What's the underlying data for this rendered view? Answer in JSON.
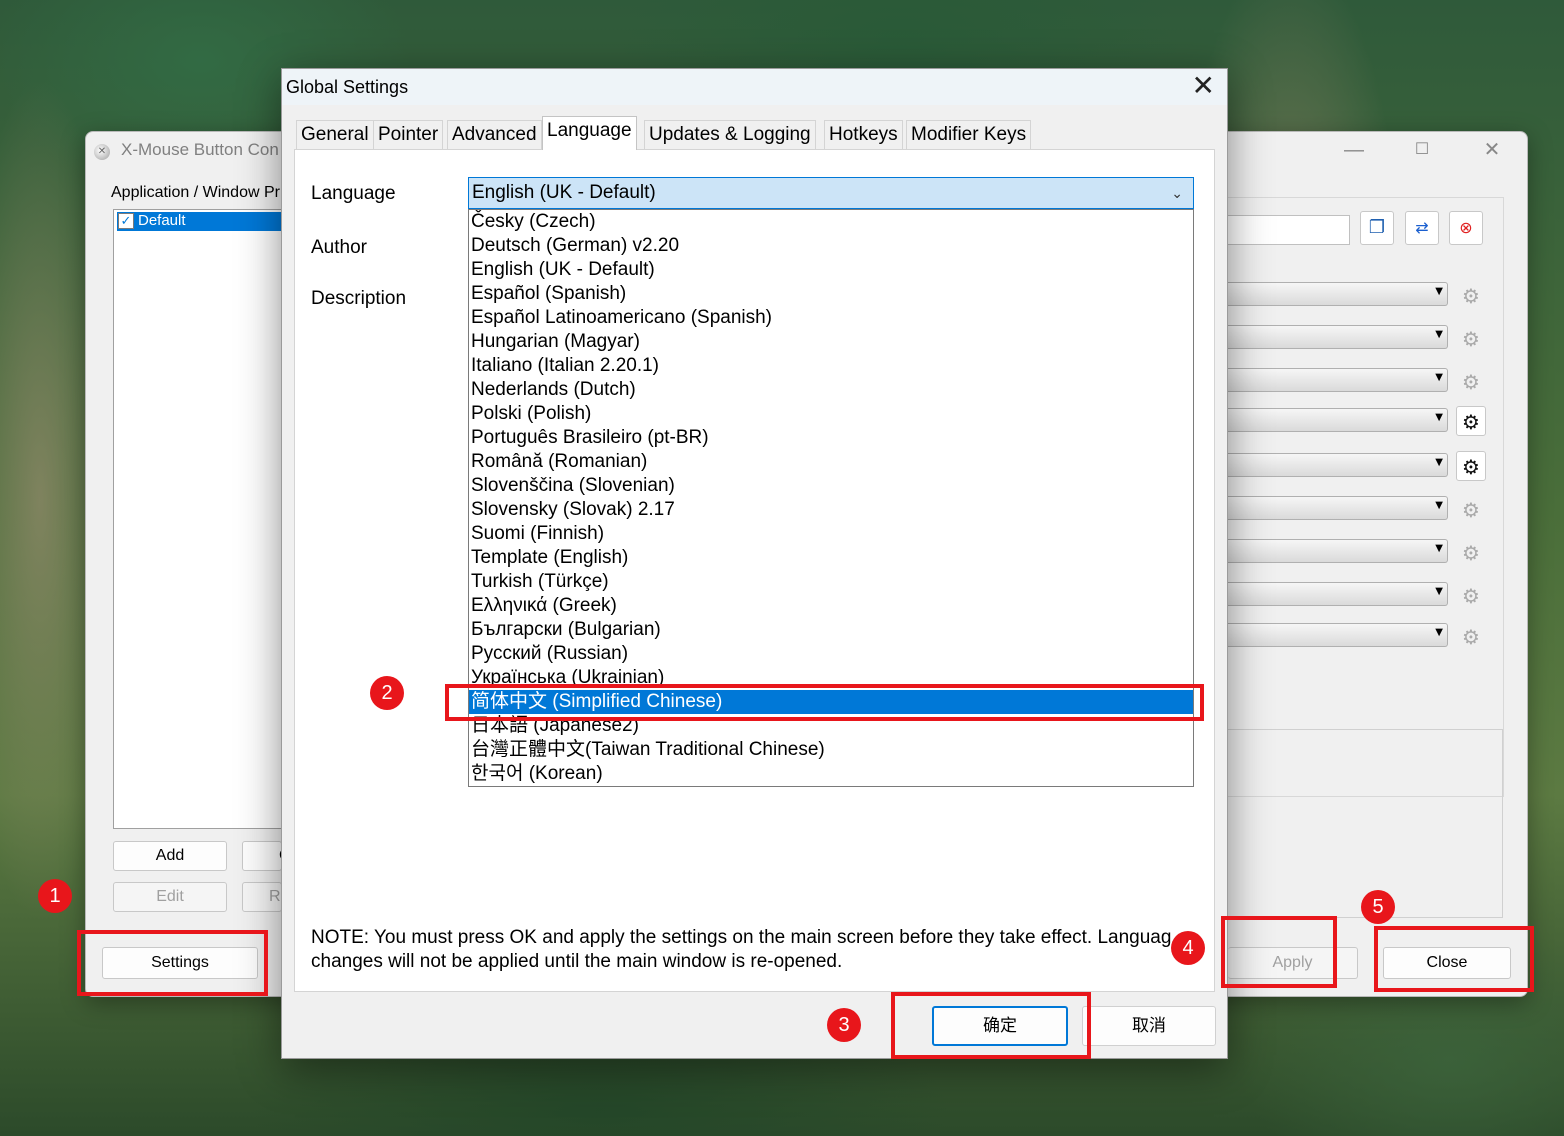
{
  "main_window": {
    "title": "X-Mouse Button Con",
    "minimize": "—",
    "maximize": "☐",
    "close": "✕",
    "apps_label": "Application / Window Pr",
    "apps_items": [
      {
        "label": "Default",
        "checked": true
      }
    ],
    "buttons": {
      "add": "Add",
      "copy_partial": "C",
      "edit": "Edit",
      "remove_partial": "R",
      "settings": "Settings",
      "apply": "Apply",
      "close": "Close"
    },
    "icon_buttons": [
      "copy-icon",
      "swap-icon",
      "remove-icon"
    ],
    "gear_rows": 9
  },
  "dialog": {
    "title": "Global Settings",
    "close_glyph": "✕",
    "tabs": [
      "General",
      "Pointer",
      "Advanced",
      "Language",
      "Updates & Logging",
      "Hotkeys",
      "Modifier Keys"
    ],
    "active_tab": "Language",
    "labels": {
      "language": "Language",
      "author": "Author",
      "description": "Description"
    },
    "language_selected": "English (UK - Default)",
    "language_options": [
      "Česky (Czech)",
      "Deutsch (German) v2.20",
      "English (UK - Default)",
      "Español (Spanish)",
      "Español Latinoamericano (Spanish)",
      "Hungarian (Magyar)",
      "Italiano (Italian 2.20.1)",
      "Nederlands (Dutch)",
      "Polski (Polish)",
      "Português Brasileiro (pt-BR)",
      "Română (Romanian)",
      "Slovenščina (Slovenian)",
      "Slovensky (Slovak) 2.17",
      "Suomi (Finnish)",
      "Template (English)",
      "Turkish (Türkçe)",
      "Ελληνικά (Greek)",
      "Български (Bulgarian)",
      "Русский (Russian)",
      "Українська (Ukrainian)",
      "简体中文 (Simplified Chinese)",
      "日本語 (Japanese2)",
      "台灣正體中文(Taiwan Traditional Chinese)",
      "한국어 (Korean)"
    ],
    "highlighted_option": "简体中文 (Simplified Chinese)",
    "note_line1": "NOTE: You must press OK and apply the settings on the main screen before they take effect. Languag",
    "note_line2": "changes will not be applied until the main window is re-opened.",
    "ok_button": "确定",
    "cancel_button": "取消"
  },
  "annotations": {
    "badge_1": "1",
    "badge_2": "2",
    "badge_3": "3",
    "badge_4": "4",
    "badge_5": "5",
    "highlight_color": "#e8161b"
  },
  "colors": {
    "selection": "#0078d7",
    "combo_focus": "#cce4f7"
  }
}
